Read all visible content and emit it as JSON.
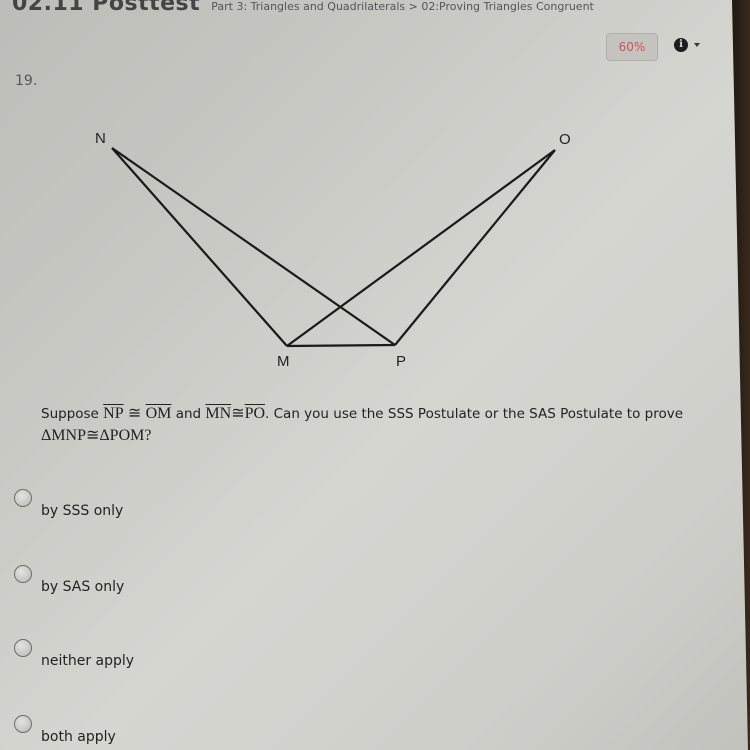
{
  "header": {
    "title": "02.11 Posttest",
    "breadcrumb": "Part 3: Triangles and Quadrilaterals > 02:Proving Triangles Congruent"
  },
  "toolbar": {
    "score": "60%",
    "info_icon": "info-icon",
    "info_glyph": "i",
    "dropdown_icon": "caret-down-icon"
  },
  "question": {
    "number": "19.",
    "figure": {
      "points": {
        "N": {
          "label": "N"
        },
        "O": {
          "label": "O"
        },
        "M": {
          "label": "M"
        },
        "P": {
          "label": "P"
        }
      },
      "segments": [
        "NM",
        "NP",
        "OM",
        "OP",
        "MP"
      ]
    },
    "prompt": {
      "lead": "Suppose",
      "seg1": "NP",
      "cong": "≅",
      "seg2": "OM",
      "and": "and",
      "seg3": "MN",
      "seg4": "PO",
      "rest": ". Can you use the SSS Postulate or the SAS Postulate to prove",
      "tri1": "ΔMNP",
      "tri2": "ΔPOM",
      "qmark": "?"
    },
    "options": [
      {
        "label": "by SSS only",
        "selected": false
      },
      {
        "label": "by SAS only",
        "selected": false
      },
      {
        "label": "neither apply",
        "selected": false
      },
      {
        "label": "both apply",
        "selected": false
      }
    ]
  }
}
